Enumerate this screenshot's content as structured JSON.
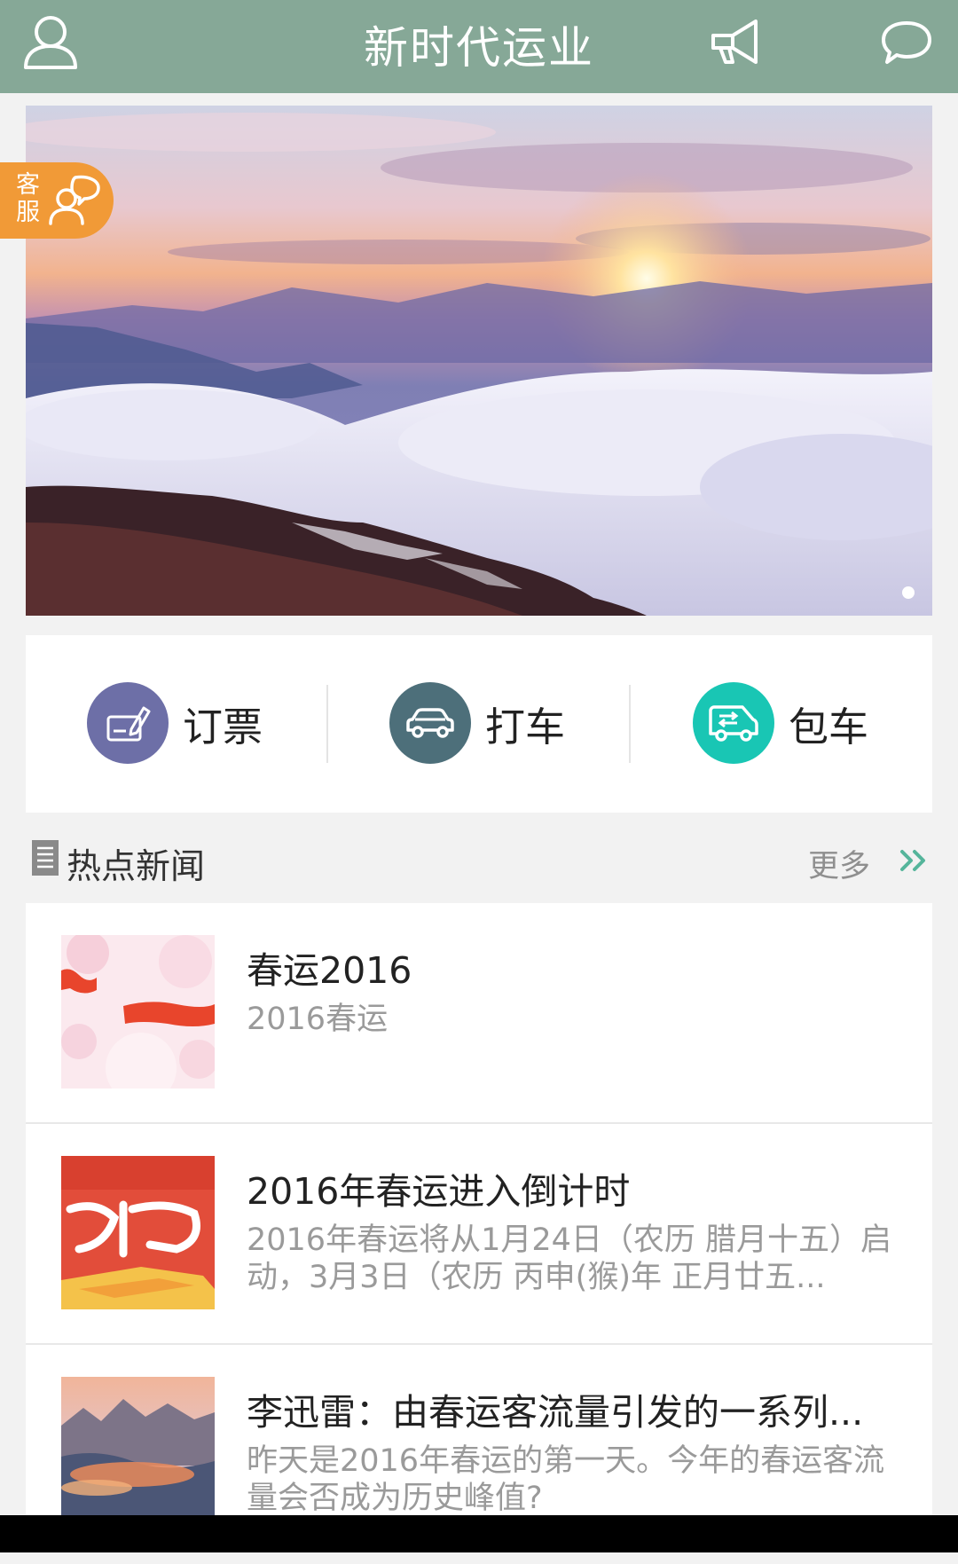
{
  "header": {
    "title": "新时代运业",
    "profile_icon": "user-icon",
    "announce_icon": "megaphone-icon",
    "message_icon": "chat-bubble-icon",
    "bg_color": "#86a897"
  },
  "banner": {
    "image": "sunrise-over-sea-of-clouds",
    "slide_indicator": "1 of 1"
  },
  "customer_service": {
    "label": "客服",
    "icon": "customer-service-icon",
    "color": "#f19a37"
  },
  "services": [
    {
      "label": "订票",
      "icon": "ticket-pen-icon",
      "color": "#6d6fa7"
    },
    {
      "label": "打车",
      "icon": "car-icon",
      "color": "#4d6f7a"
    },
    {
      "label": "包车",
      "icon": "van-icon",
      "color": "#19c6b4"
    }
  ],
  "news_section": {
    "title": "热点新闻",
    "more_label": "更多",
    "more_icon": "double-chevron-right-icon"
  },
  "news": [
    {
      "title": "春运2016",
      "summary": "2016春运",
      "thumb": "spring-festival-red-text-thumbnail"
    },
    {
      "title": "2016年春运进入倒计时",
      "summary": "2016年春运将从1月24日（农历 腊月十五）启动，3月3日（农历 丙申(猴)年 正月廿五...",
      "thumb": "red-calligraphy-thumbnail"
    },
    {
      "title": "李迅雷：由春运客流量引发的一系列...",
      "summary": "昨天是2016年春运的第一天。今年的春运客流量会否成为历史峰值?",
      "thumb": "mountain-sunset-thumbnail"
    }
  ]
}
